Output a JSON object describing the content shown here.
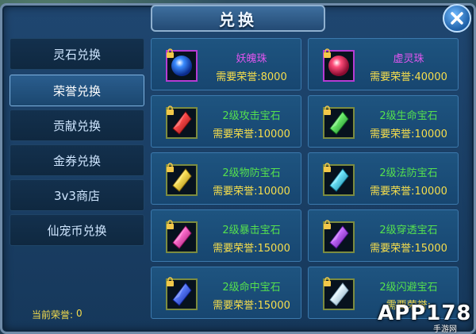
{
  "background": {
    "digits": "#51669739"
  },
  "window": {
    "title": "兑换",
    "close_icon": "close-icon",
    "colors": {
      "accent": "#6fb9ff",
      "frame": "#6f8ba8",
      "price": "#f7de4c",
      "gem_name": "#55e04e",
      "bead_name": "#e156f0"
    }
  },
  "sidebar": {
    "items": [
      {
        "label": "灵石兑换",
        "active": false
      },
      {
        "label": "荣誉兑换",
        "active": true
      },
      {
        "label": "贡献兑换",
        "active": false
      },
      {
        "label": "金券兑换",
        "active": false
      },
      {
        "label": "3v3商店",
        "active": false
      },
      {
        "label": "仙宠币兑换",
        "active": false
      }
    ],
    "current_honor_label": "当前荣誉:",
    "current_honor_value": "0"
  },
  "items": [
    {
      "name": "妖魄珠",
      "price_label": "需要荣誉:",
      "price": "8000",
      "gem": "blue-bead",
      "name_color": "purple"
    },
    {
      "name": "虚灵珠",
      "price_label": "需要荣誉:",
      "price": "40000",
      "gem": "red-bead",
      "name_color": "purple"
    },
    {
      "name": "2级攻击宝石",
      "price_label": "需要荣誉:",
      "price": "10000",
      "gem": "red-crystal",
      "name_color": "green"
    },
    {
      "name": "2级生命宝石",
      "price_label": "需要荣誉:",
      "price": "10000",
      "gem": "green-crystal",
      "name_color": "green"
    },
    {
      "name": "2级物防宝石",
      "price_label": "需要荣誉:",
      "price": "10000",
      "gem": "yellow-crystal",
      "name_color": "green"
    },
    {
      "name": "2级法防宝石",
      "price_label": "需要荣誉:",
      "price": "10000",
      "gem": "cyan-crystal",
      "name_color": "green"
    },
    {
      "name": "2级暴击宝石",
      "price_label": "需要荣誉:",
      "price": "15000",
      "gem": "pink-crystal",
      "name_color": "green"
    },
    {
      "name": "2级穿透宝石",
      "price_label": "需要荣誉:",
      "price": "15000",
      "gem": "violet-crystal",
      "name_color": "green"
    },
    {
      "name": "2级命中宝石",
      "price_label": "需要荣誉:",
      "price": "15000",
      "gem": "blue-crystal",
      "name_color": "green"
    },
    {
      "name": "2级闪避宝石",
      "price_label": "需要荣誉:",
      "price": "",
      "gem": "white-crystal",
      "name_color": "green"
    }
  ],
  "watermark": {
    "main": "APP178",
    "sub": "手游网"
  }
}
